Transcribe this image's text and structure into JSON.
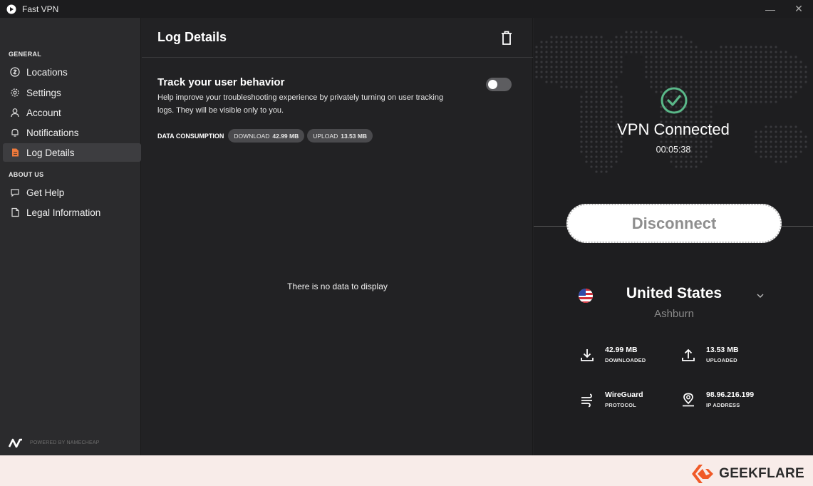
{
  "window": {
    "title": "Fast VPN",
    "minimize": "—",
    "close": "✕"
  },
  "sidebar": {
    "general_label": "GENERAL",
    "about_label": "ABOUT US",
    "items": [
      {
        "label": "Locations",
        "icon": "locations-icon"
      },
      {
        "label": "Settings",
        "icon": "gear-icon"
      },
      {
        "label": "Account",
        "icon": "user-icon"
      },
      {
        "label": "Notifications",
        "icon": "bell-icon"
      },
      {
        "label": "Log Details",
        "icon": "document-icon",
        "active": true
      },
      {
        "label": "Get Help",
        "icon": "help-chat-icon"
      },
      {
        "label": "Legal Information",
        "icon": "file-icon"
      }
    ],
    "powered_by": "POWERED BY NAMECHEAP"
  },
  "main": {
    "title": "Log Details",
    "track": {
      "title": "Track your user behavior",
      "description": "Help improve your troubleshooting experience by privately turning on user tracking logs. They will be visible only to you.",
      "enabled": false
    },
    "consumption": {
      "label": "DATA CONSUMPTION",
      "download_label": "DOWNLOAD",
      "download_value": "42.99 MB",
      "upload_label": "UPLOAD",
      "upload_value": "13.53 MB"
    },
    "empty_text": "There is no data to display"
  },
  "vpn": {
    "status": "VPN Connected",
    "timer": "00:05:38",
    "disconnect_label": "Disconnect",
    "country": "United States",
    "city": "Ashburn",
    "stats": {
      "downloaded_value": "42.99 MB",
      "downloaded_label": "DOWNLOADED",
      "uploaded_value": "13.53 MB",
      "uploaded_label": "UPLOADED",
      "protocol_value": "WireGuard",
      "protocol_label": "PROTOCOL",
      "ip_value": "98.96.216.199",
      "ip_label": "IP ADDRESS"
    },
    "status_color": "#5ab889"
  },
  "watermark": {
    "brand": "GEEKFLARE",
    "color": "#f05a28"
  }
}
